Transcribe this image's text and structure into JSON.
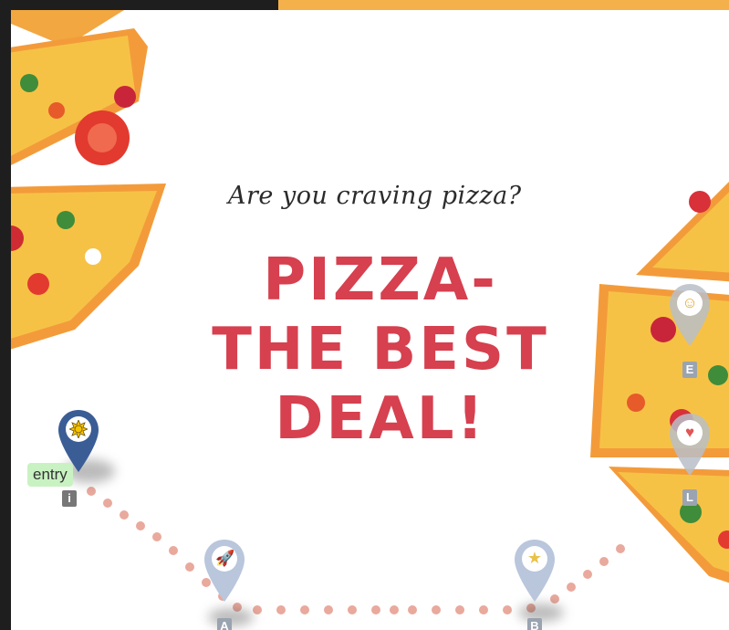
{
  "colors": {
    "accent_bar": "#f4b04a",
    "headline": "#d6404f",
    "dot": "#e9a99d"
  },
  "poster": {
    "tagline": "Are you craving pizza?",
    "headline_lines": [
      "PIZZA-",
      "THE BEST",
      "DEAL!"
    ]
  },
  "entry": {
    "label": "entry",
    "letter": "i",
    "icon": "sun-icon"
  },
  "waypoints": [
    {
      "letter": "A",
      "icon": "rocket-icon"
    },
    {
      "letter": "B",
      "icon": "star-icon"
    },
    {
      "letter": "E",
      "icon": "smiley-icon"
    },
    {
      "letter": "L",
      "icon": "heart-eyes-icon"
    }
  ]
}
